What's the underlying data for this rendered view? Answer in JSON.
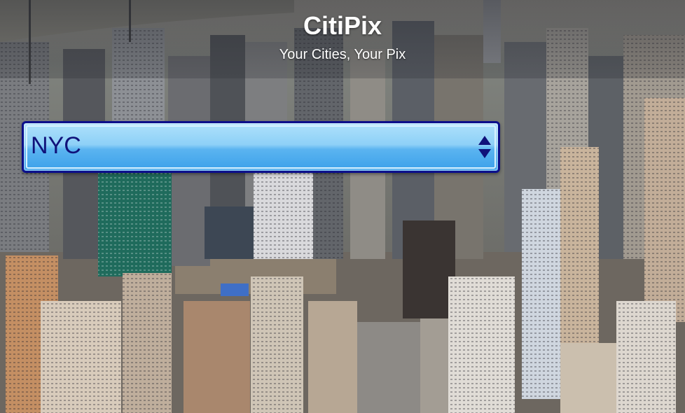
{
  "app": {
    "title": "CitiPix",
    "subtitle": "Your Cities, Your Pix"
  },
  "city_select": {
    "selected": "NYC",
    "icon": "up-down-arrows-icon",
    "text_color": "#10127a",
    "border_color": "#0c0f8a",
    "fill_top": "#aee1fb",
    "fill_bottom": "#3aa0ea"
  },
  "background": {
    "subject": "aerial-city-skyline-photo"
  }
}
